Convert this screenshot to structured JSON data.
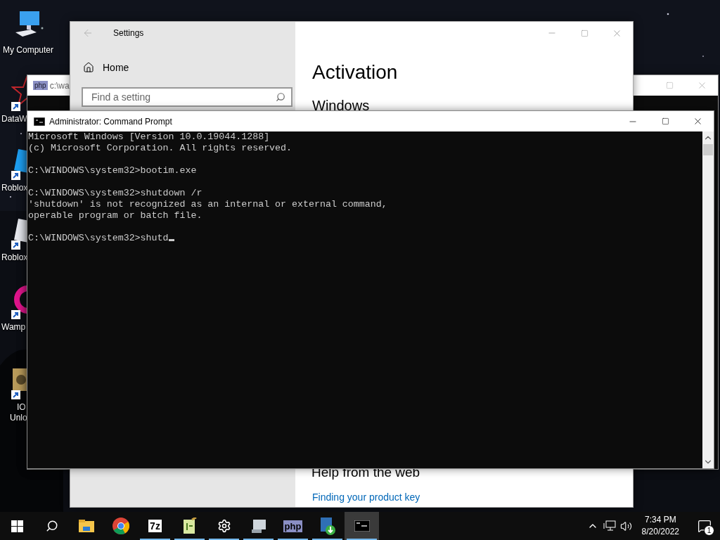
{
  "desktop_icons": [
    {
      "kind": "computer",
      "lines": [
        "My Computer"
      ],
      "shortcut": false
    },
    {
      "kind": "star",
      "lines": [
        "DataW"
      ],
      "shortcut": true
    },
    {
      "kind": "tile",
      "lines": [
        "Roblox"
      ],
      "shortcut": true
    },
    {
      "kind": "tile-light",
      "lines": [
        "Roblox"
      ],
      "shortcut": true
    },
    {
      "kind": "wamp",
      "lines": [
        "Wamp"
      ],
      "shortcut": true
    },
    {
      "kind": "gear",
      "lines": [
        "IO",
        "Unlo"
      ],
      "shortcut": true
    }
  ],
  "php_window": {
    "icon": "php",
    "title": "c:\\wa"
  },
  "settings": {
    "title": "Settings",
    "home": "Home",
    "search": {
      "placeholder": "Find a setting"
    },
    "heading": "Activation",
    "section": "Windows",
    "help_heading": "Help from the web",
    "help_link": "Finding your product key"
  },
  "console": {
    "title": "Administrator: Command Prompt",
    "cursor": true,
    "blocks": [
      [
        "Microsoft Windows [Version 10.0.19044.1288]",
        "(c) Microsoft Corporation. All rights reserved."
      ],
      [
        "C:\\WINDOWS\\system32>bootim.exe"
      ],
      [
        "C:\\WINDOWS\\system32>shutdown /r",
        "'shutdown' is not recognized as an internal or external command,",
        "operable program or batch file."
      ],
      [
        "C:\\WINDOWS\\system32>shutd"
      ]
    ]
  },
  "taskbar": {
    "items": [
      {
        "kind": "start",
        "running": false,
        "selected": false
      },
      {
        "kind": "search",
        "running": false,
        "selected": false
      },
      {
        "kind": "folder",
        "running": false,
        "selected": false
      },
      {
        "kind": "browser",
        "running": false,
        "selected": false
      },
      {
        "kind": "text",
        "glyph": "7z",
        "running": true,
        "selected": false
      },
      {
        "kind": "notepad",
        "running": true,
        "selected": false
      },
      {
        "kind": "gear",
        "running": true,
        "selected": false
      },
      {
        "kind": "monitor",
        "running": true,
        "selected": false
      },
      {
        "kind": "text",
        "glyph": "php",
        "running": true,
        "selected": false
      },
      {
        "kind": "installer",
        "running": true,
        "selected": false
      },
      {
        "kind": "console",
        "running": true,
        "selected": true
      }
    ],
    "clock": {
      "time": "7:34 PM",
      "date": "8/20/2022"
    },
    "notifications": "1"
  }
}
